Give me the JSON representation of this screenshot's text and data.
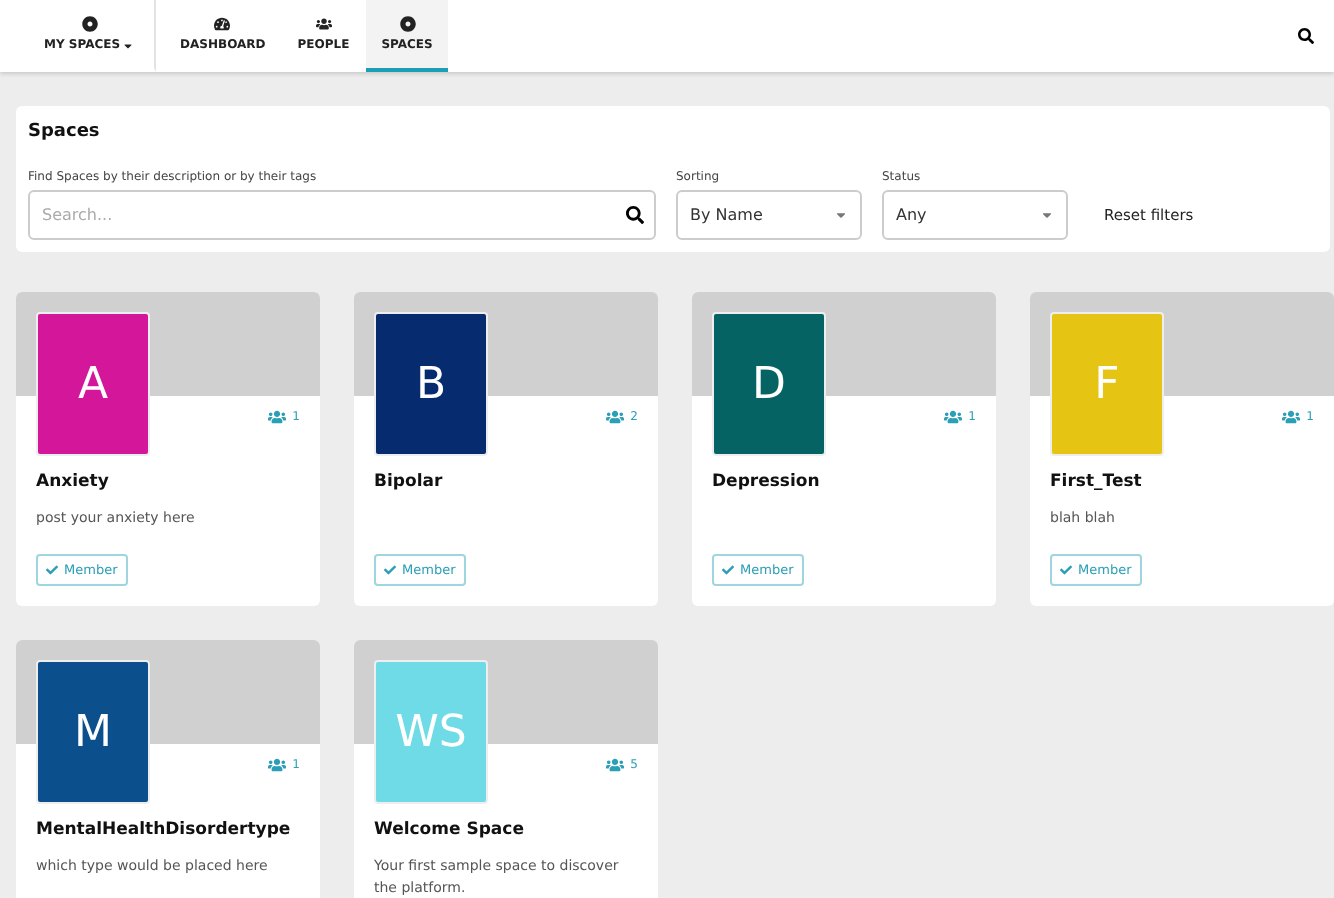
{
  "nav": {
    "tabs": [
      {
        "label": "MY SPACES",
        "kind": "target",
        "caret": true,
        "selected": false
      },
      {
        "label": "DASHBOARD",
        "kind": "gauge",
        "caret": false,
        "selected": false
      },
      {
        "label": "PEOPLE",
        "kind": "users",
        "caret": false,
        "selected": false
      },
      {
        "label": "SPACES",
        "kind": "target",
        "caret": false,
        "selected": true
      }
    ]
  },
  "filters": {
    "title": "Spaces",
    "search_label": "Find Spaces by their description or by their tags",
    "search_placeholder": "Search...",
    "sorting_label": "Sorting",
    "sorting_value": "By Name",
    "status_label": "Status",
    "status_value": "Any",
    "reset": "Reset filters"
  },
  "spaces": [
    {
      "initials": "A",
      "color": "#d4169b",
      "name": "Anxiety",
      "description": "post your anxiety here",
      "members": "1",
      "badge": "Member"
    },
    {
      "initials": "B",
      "color": "#062b6e",
      "name": "Bipolar",
      "members": "2",
      "badge": "Member"
    },
    {
      "initials": "D",
      "color": "#066363",
      "name": "Depression",
      "members": "1",
      "badge": "Member"
    },
    {
      "initials": "F",
      "color": "#e6c414",
      "name": "First_Test",
      "description": "blah blah",
      "members": "1",
      "badge": "Member"
    },
    {
      "initials": "M",
      "color": "#0b4f8c",
      "name": "MentalHealthDisordertype",
      "description": "which type would be placed here",
      "members": "1"
    },
    {
      "initials": "WS",
      "color": "#6fdbe6",
      "name": "Welcome Space",
      "description": "Your first sample space to discover the platform.",
      "members": "5"
    }
  ]
}
